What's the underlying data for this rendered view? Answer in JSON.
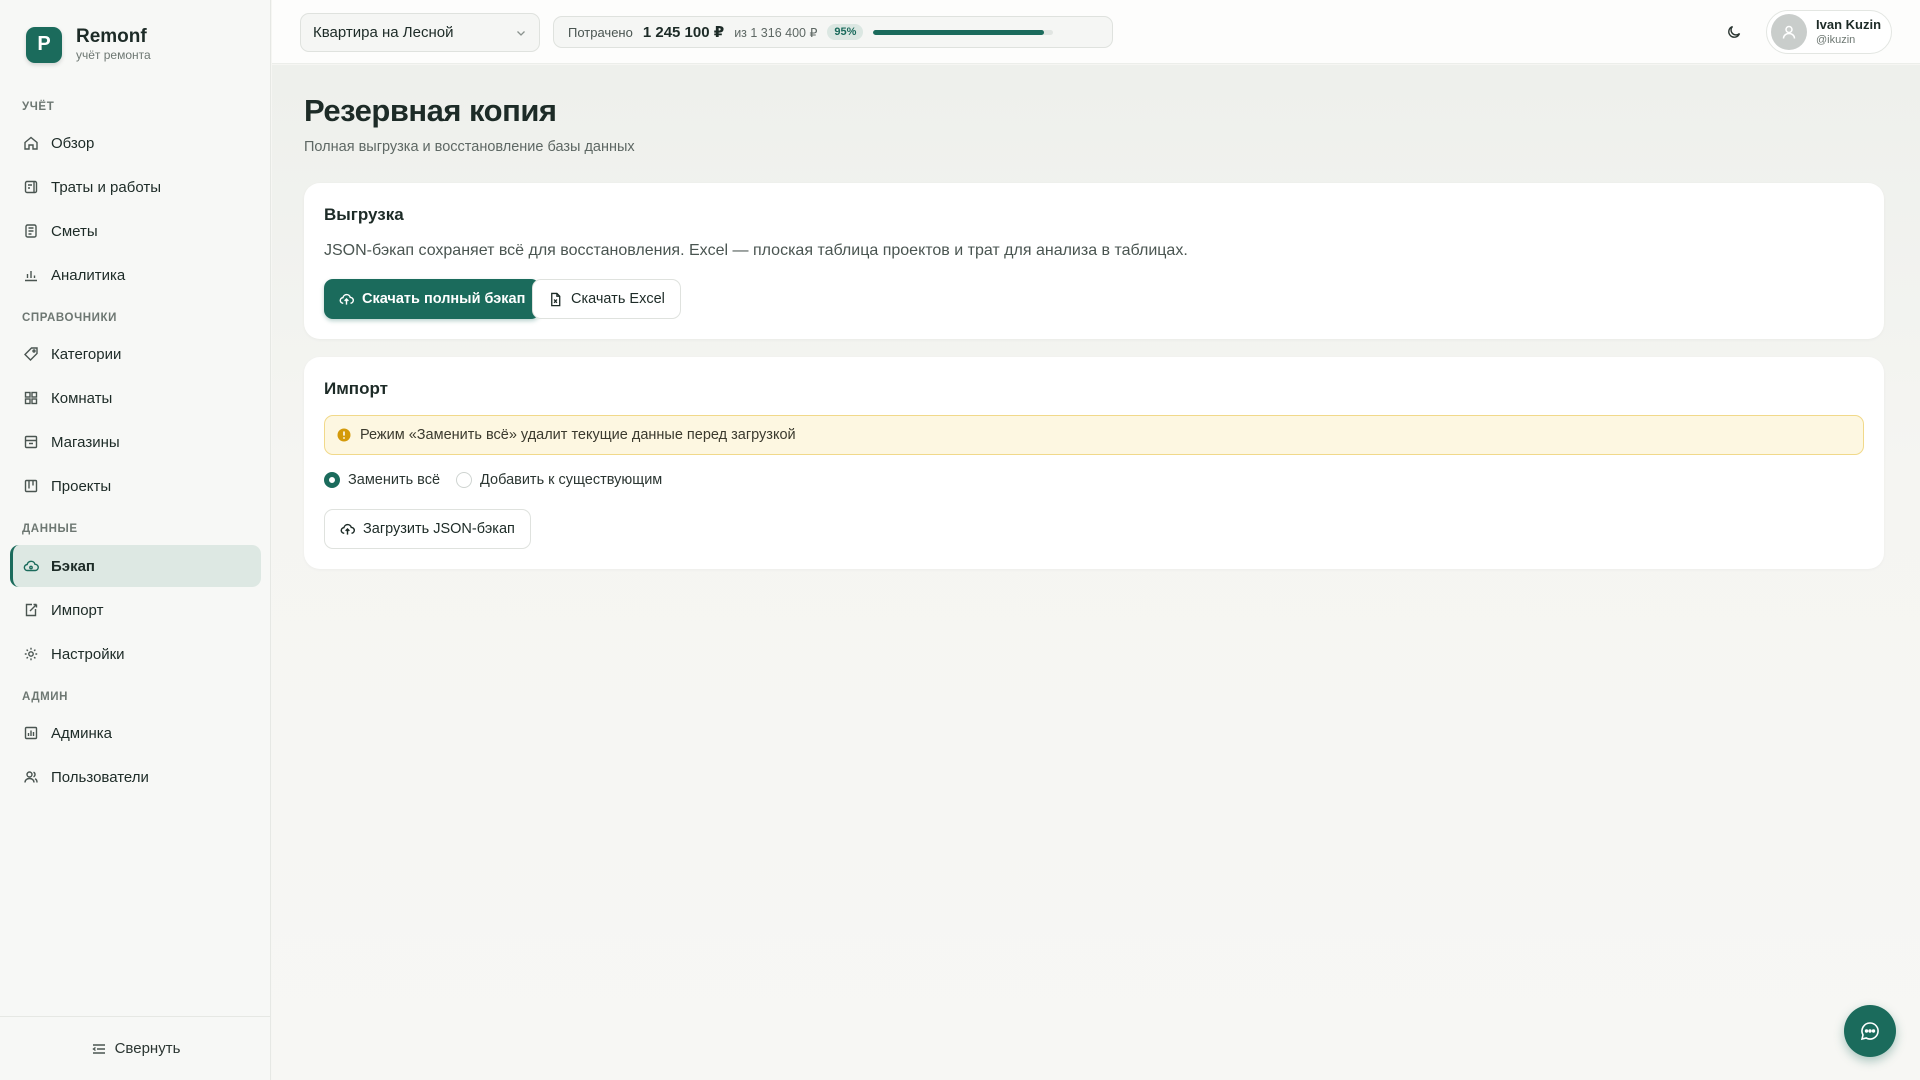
{
  "brand": {
    "logo_letter": "P",
    "name": "Remonf",
    "subtitle": "учёт ремонта"
  },
  "sidebar": {
    "sections": [
      {
        "label": "Учёт",
        "items": [
          {
            "label": "Обзор",
            "icon": "home-icon"
          },
          {
            "label": "Траты и работы",
            "icon": "receipt-icon"
          },
          {
            "label": "Сметы",
            "icon": "estimate-icon"
          },
          {
            "label": "Аналитика",
            "icon": "chart-icon"
          }
        ]
      },
      {
        "label": "Справочники",
        "items": [
          {
            "label": "Категории",
            "icon": "tag-icon"
          },
          {
            "label": "Комнаты",
            "icon": "grid-icon"
          },
          {
            "label": "Магазины",
            "icon": "store-icon"
          },
          {
            "label": "Проекты",
            "icon": "kanban-icon"
          }
        ]
      },
      {
        "label": "Данные",
        "items": [
          {
            "label": "Бэкап",
            "icon": "cloud-icon",
            "active": true
          },
          {
            "label": "Импорт",
            "icon": "import-icon"
          },
          {
            "label": "Настройки",
            "icon": "gear-icon"
          }
        ]
      },
      {
        "label": "Админ",
        "items": [
          {
            "label": "Админка",
            "icon": "admin-icon"
          },
          {
            "label": "Пользователи",
            "icon": "users-icon"
          }
        ]
      }
    ],
    "collapse_label": "Свернуть"
  },
  "topbar": {
    "project": "Квартира на Лесной",
    "budget": {
      "label": "Потрачено",
      "spent": "1 245 100 ₽",
      "total": "из 1 316 400 ₽",
      "percent_label": "95%",
      "fraction": 0.95
    },
    "user": {
      "name": "Ivan Kuzin",
      "handle": "@ikuzin"
    }
  },
  "page": {
    "title": "Резервная копия",
    "subtitle": "Полная выгрузка и восстановление базы данных"
  },
  "export_card": {
    "title": "Выгрузка",
    "description": "JSON-бэкап сохраняет всё для восстановления. Excel — плоская таблица проектов и трат для анализа в таблицах.",
    "primary_button": "Скачать полный бэкап",
    "secondary_button": "Скачать Excel"
  },
  "import_card": {
    "title": "Импорт",
    "warning": "Режим «Заменить всё» удалит текущие данные перед загрузкой",
    "mode_replace": "Заменить всё",
    "mode_append": "Добавить к существующим",
    "selected_mode": "replace",
    "upload_button": "Загрузить JSON-бэкап"
  },
  "colors": {
    "accent": "#1b6b5c",
    "warning_bg": "#fdf7e1",
    "warning_border": "#f1d98a",
    "warning_icon": "#d49a0a"
  }
}
